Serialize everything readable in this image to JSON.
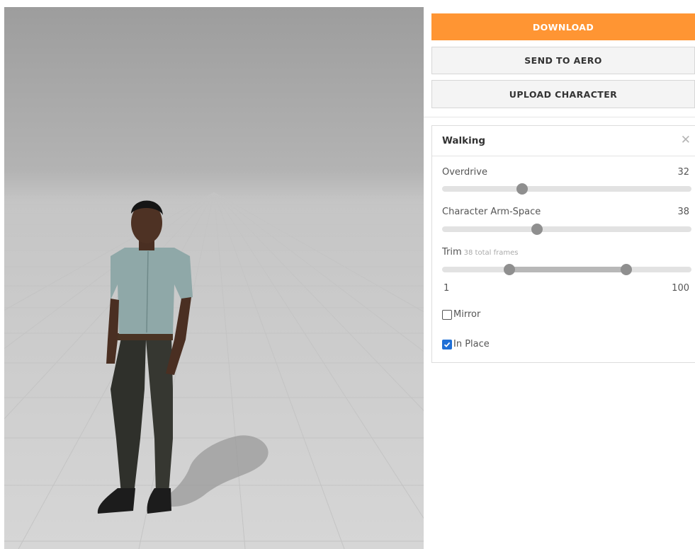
{
  "buttons": {
    "download": "DOWNLOAD",
    "send_to_aero": "SEND TO AERO",
    "upload_character": "UPLOAD CHARACTER"
  },
  "animation_panel": {
    "title": "Walking",
    "overdrive": {
      "label": "Overdrive",
      "value": "32",
      "level": 0.32
    },
    "arm_space": {
      "label": "Character Arm-Space",
      "value": "38",
      "level": 0.38
    },
    "trim": {
      "label": "Trim",
      "subtitle": "38 total frames",
      "min_label": "1",
      "max_label": "100",
      "start_level": 0.27,
      "end_level": 0.74
    },
    "mirror": {
      "label": "Mirror",
      "checked": false
    },
    "in_place": {
      "label": "In Place",
      "checked": true
    }
  },
  "colors": {
    "accent": "#ff9533",
    "checkbox": "#1f6fd6"
  },
  "icons": {
    "close": "close-icon"
  }
}
